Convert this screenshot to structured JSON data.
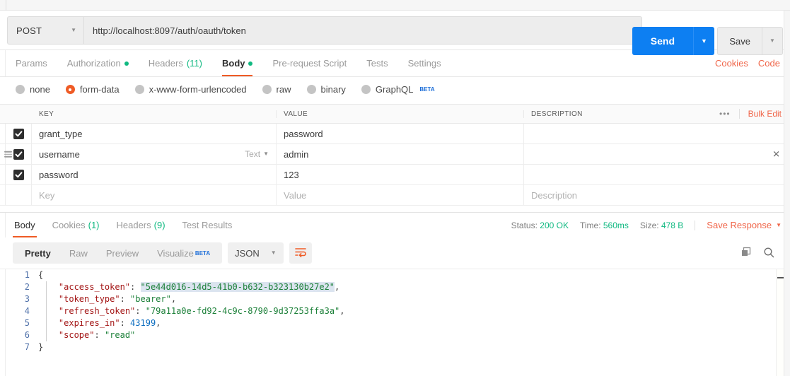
{
  "request": {
    "method": "POST",
    "url": "http://localhost:8097/auth/oauth/token",
    "send_label": "Send",
    "save_label": "Save",
    "tabs": [
      {
        "label": "Params",
        "badge": "",
        "active": false
      },
      {
        "label": "Authorization",
        "badge": "dot",
        "active": false
      },
      {
        "label": "Headers",
        "count": "(11)",
        "active": false
      },
      {
        "label": "Body",
        "badge": "dot",
        "active": true
      },
      {
        "label": "Pre-request Script",
        "badge": "",
        "active": false
      },
      {
        "label": "Tests",
        "badge": "",
        "active": false
      },
      {
        "label": "Settings",
        "badge": "",
        "active": false
      }
    ],
    "links": {
      "cookies": "Cookies",
      "code": "Code"
    },
    "body_types": [
      {
        "label": "none",
        "selected": false
      },
      {
        "label": "form-data",
        "selected": true
      },
      {
        "label": "x-www-form-urlencoded",
        "selected": false
      },
      {
        "label": "raw",
        "selected": false
      },
      {
        "label": "binary",
        "selected": false
      },
      {
        "label": "GraphQL",
        "selected": false,
        "sup": "BETA"
      }
    ]
  },
  "kv_table": {
    "headers": {
      "key": "KEY",
      "value": "VALUE",
      "description": "DESCRIPTION"
    },
    "bulk_edit": "Bulk Edit",
    "more_icon": "•••",
    "rows": [
      {
        "checked": true,
        "key": "grant_type",
        "value": "password",
        "description": "",
        "hovered": false
      },
      {
        "checked": true,
        "key": "username",
        "value": "admin",
        "description": "",
        "hovered": true,
        "type_label": "Text"
      },
      {
        "checked": true,
        "key": "password",
        "value": "123",
        "description": "",
        "hovered": false
      }
    ],
    "placeholder_row": {
      "key": "Key",
      "value": "Value",
      "description": "Description"
    }
  },
  "response": {
    "tabs": [
      {
        "label": "Body",
        "count": "",
        "active": true
      },
      {
        "label": "Cookies",
        "count": "(1)",
        "active": false
      },
      {
        "label": "Headers",
        "count": "(9)",
        "active": false
      },
      {
        "label": "Test Results",
        "count": "",
        "active": false
      }
    ],
    "meta": {
      "status_label": "Status:",
      "status_value": "200 OK",
      "time_label": "Time:",
      "time_value": "560ms",
      "size_label": "Size:",
      "size_value": "478 B",
      "save_response": "Save Response"
    },
    "formats": [
      {
        "label": "Pretty",
        "active": true
      },
      {
        "label": "Raw",
        "active": false
      },
      {
        "label": "Preview",
        "active": false
      },
      {
        "label": "Visualize",
        "active": false,
        "sup": "BETA"
      }
    ],
    "language": "JSON",
    "code_lines": [
      {
        "n": "1",
        "segments": [
          {
            "t": "{",
            "c": "k-punc"
          }
        ]
      },
      {
        "n": "2",
        "segments": [
          {
            "t": "    \"access_token\"",
            "c": "k-key"
          },
          {
            "t": ": ",
            "c": "k-punc"
          },
          {
            "t": "\"5e44d016-14d5-41b0-b632-b323130b27e2\"",
            "c": "k-str sel-hl"
          },
          {
            "t": ",",
            "c": "k-punc"
          }
        ]
      },
      {
        "n": "3",
        "segments": [
          {
            "t": "    \"token_type\"",
            "c": "k-key"
          },
          {
            "t": ": ",
            "c": "k-punc"
          },
          {
            "t": "\"bearer\"",
            "c": "k-str"
          },
          {
            "t": ",",
            "c": "k-punc"
          }
        ]
      },
      {
        "n": "4",
        "segments": [
          {
            "t": "    \"refresh_token\"",
            "c": "k-key"
          },
          {
            "t": ": ",
            "c": "k-punc"
          },
          {
            "t": "\"79a11a0e-fd92-4c9c-8790-9d37253ffa3a\"",
            "c": "k-str"
          },
          {
            "t": ",",
            "c": "k-punc"
          }
        ]
      },
      {
        "n": "5",
        "segments": [
          {
            "t": "    \"expires_in\"",
            "c": "k-key"
          },
          {
            "t": ": ",
            "c": "k-punc"
          },
          {
            "t": "43199",
            "c": "k-num"
          },
          {
            "t": ",",
            "c": "k-punc"
          }
        ]
      },
      {
        "n": "6",
        "segments": [
          {
            "t": "    \"scope\"",
            "c": "k-key"
          },
          {
            "t": ": ",
            "c": "k-punc"
          },
          {
            "t": "\"read\"",
            "c": "k-str"
          }
        ]
      },
      {
        "n": "7",
        "segments": [
          {
            "t": "}",
            "c": "k-punc"
          }
        ]
      }
    ]
  },
  "colors": {
    "accent_orange": "#ef5b25",
    "link_orange": "#f0664a",
    "send_blue": "#0d7ff2",
    "status_green": "#10b981",
    "beta_blue": "#1e6fd9"
  }
}
